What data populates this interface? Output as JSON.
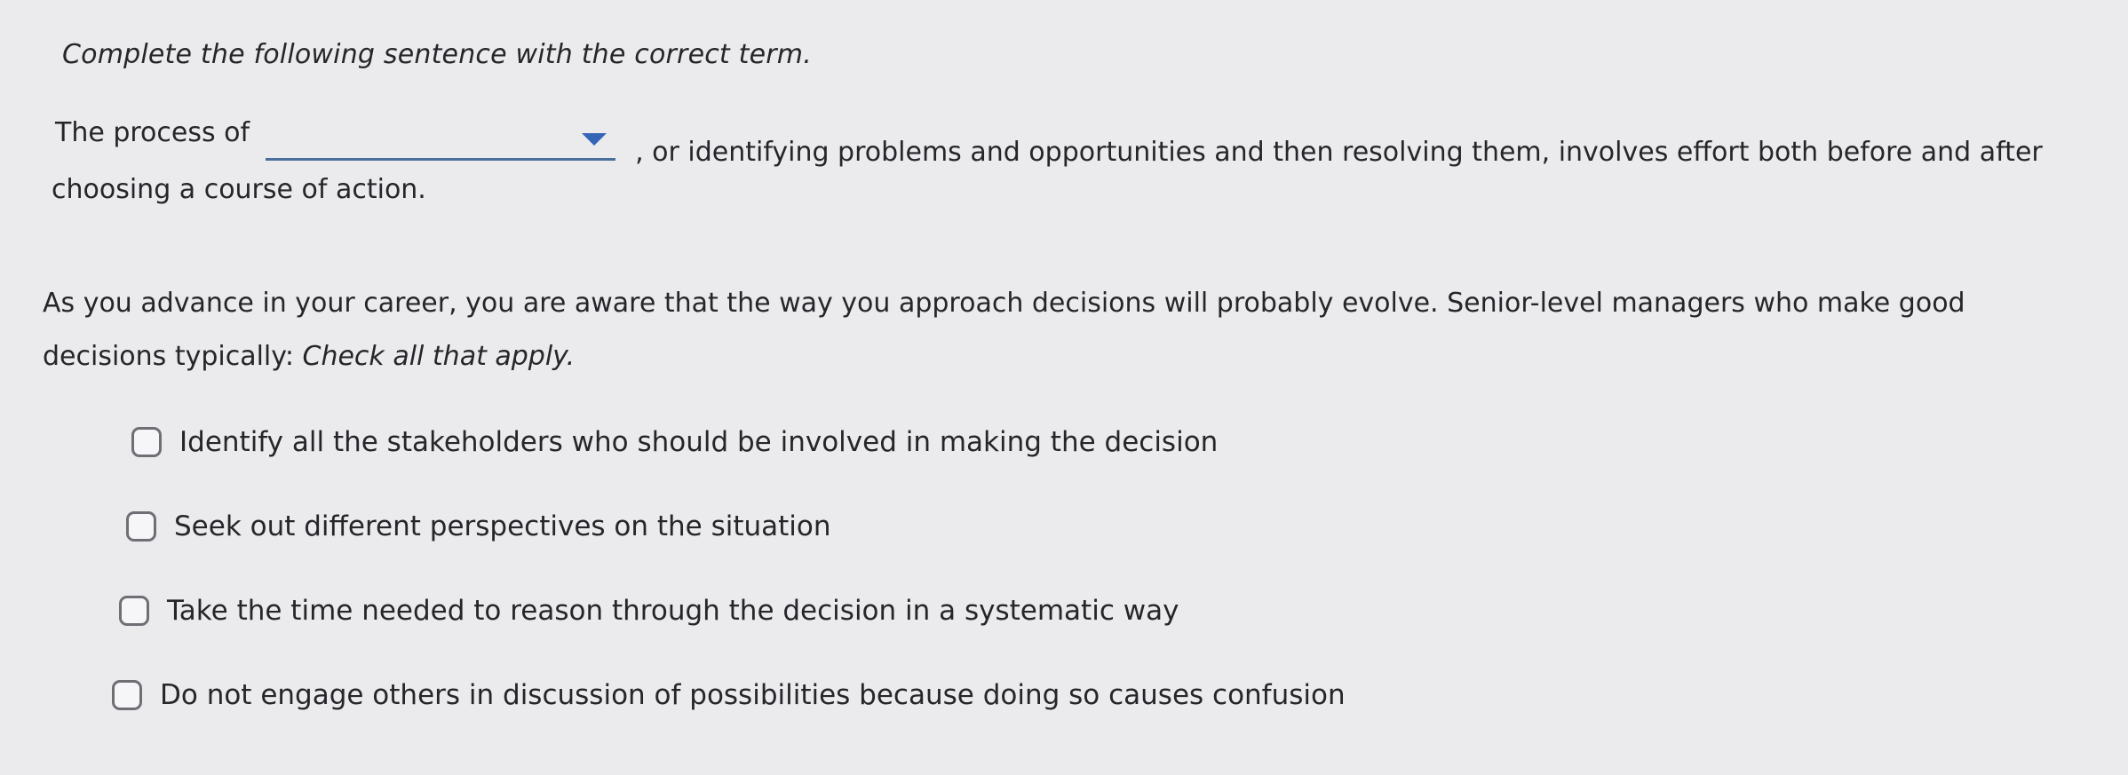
{
  "instruction": "Complete the following sentence with the correct term.",
  "question1": {
    "prefix": "The process of",
    "dropdown": {
      "selected_value": ""
    },
    "suffix": ", or identifying problems and opportunities and then resolving them, involves effort both before and after",
    "line2": "choosing a course of action."
  },
  "question2": {
    "text": "As you advance in your career, you are aware that the way you approach decisions will probably evolve. Senior-level managers who make good decisions typically:",
    "instruction": "Check all that apply."
  },
  "options": [
    {
      "label": "Identify all the stakeholders who should be involved in making the decision",
      "checked": false
    },
    {
      "label": "Seek out different perspectives on the situation",
      "checked": false
    },
    {
      "label": "Take the time needed to reason through the decision in a systematic way",
      "checked": false
    },
    {
      "label": "Do not engage others in discussion of possibilities because doing so causes confusion",
      "checked": false
    }
  ],
  "colors": {
    "background": "#ebebee",
    "text": "#26262a",
    "dropdown_arrow": "#3566b6",
    "dropdown_underline": "#4a6f9c",
    "checkbox_border": "#6e6e74"
  }
}
